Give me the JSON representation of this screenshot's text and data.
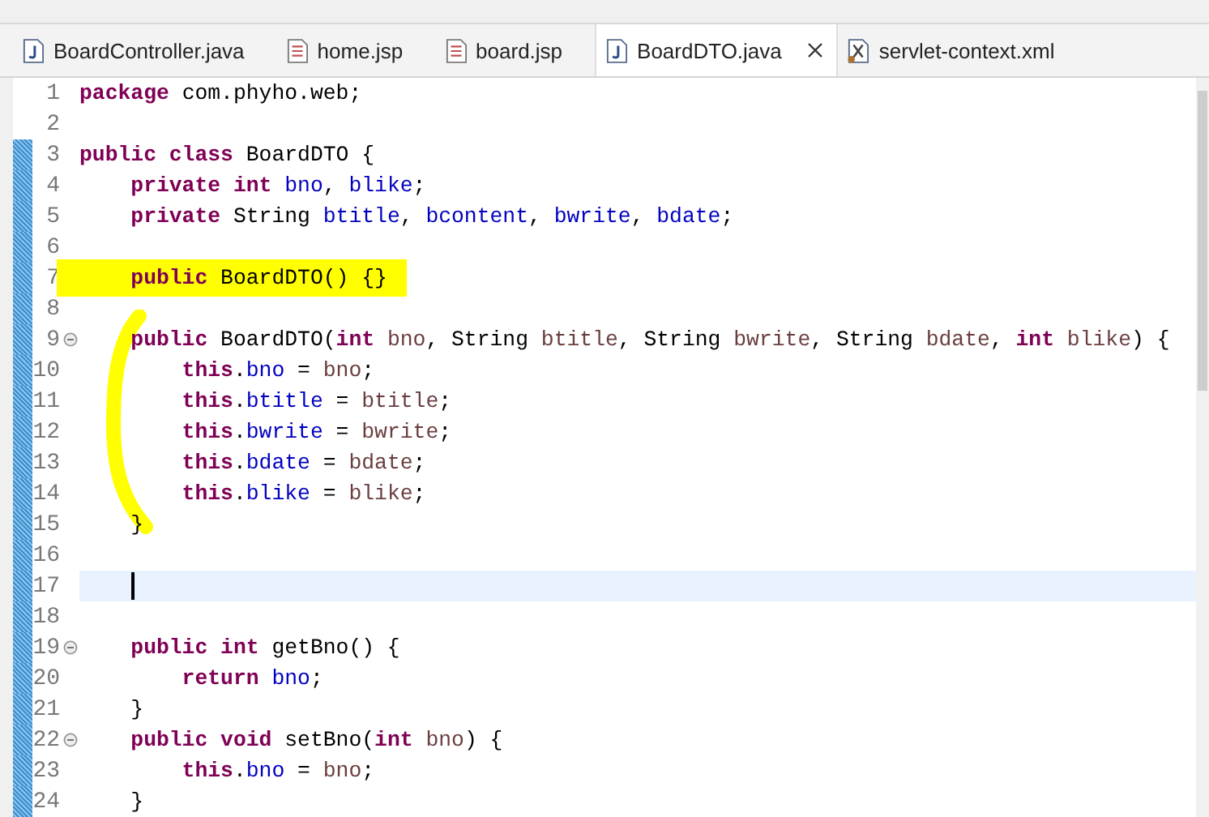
{
  "tabs": [
    {
      "label": "BoardController.java",
      "kind": "java",
      "selected": false
    },
    {
      "label": "home.jsp",
      "kind": "jsp",
      "selected": false
    },
    {
      "label": "board.jsp",
      "kind": "jsp",
      "selected": false
    },
    {
      "label": "BoardDTO.java",
      "kind": "java",
      "selected": true
    },
    {
      "label": "servlet-context.xml",
      "kind": "xml",
      "selected": false
    }
  ],
  "editor": {
    "lines": [
      {
        "number": "1",
        "changed": false,
        "fold": false,
        "current": false,
        "highlighted": false,
        "tokens": [
          {
            "text": "package",
            "kind": "keyword"
          },
          {
            "text": " com.phyho.web;",
            "kind": "plain"
          }
        ]
      },
      {
        "number": "2",
        "changed": false,
        "fold": false,
        "current": false,
        "highlighted": false
      },
      {
        "number": "3",
        "changed": true,
        "fold": false,
        "current": false,
        "highlighted": false,
        "tokens": [
          {
            "text": "public class",
            "kind": "keyword"
          },
          {
            "text": " BoardDTO {",
            "kind": "plain"
          }
        ]
      },
      {
        "number": "4",
        "changed": true,
        "fold": false,
        "current": false,
        "highlighted": false,
        "tokens": [
          {
            "text": "    private int",
            "kind": "keyword"
          },
          {
            "text": " bno",
            "kind": "field"
          },
          {
            "text": ", ",
            "kind": "plain"
          },
          {
            "text": "blike",
            "kind": "field"
          },
          {
            "text": ";",
            "kind": "plain"
          }
        ]
      },
      {
        "number": "5",
        "changed": true,
        "fold": false,
        "current": false,
        "highlighted": false,
        "tokens": [
          {
            "text": "    private",
            "kind": "keyword"
          },
          {
            "text": " String ",
            "kind": "plain"
          },
          {
            "text": "btitle",
            "kind": "field"
          },
          {
            "text": ", ",
            "kind": "plain"
          },
          {
            "text": "bcontent",
            "kind": "field"
          },
          {
            "text": ", ",
            "kind": "plain"
          },
          {
            "text": "bwrite",
            "kind": "field"
          },
          {
            "text": ", ",
            "kind": "plain"
          },
          {
            "text": "bdate",
            "kind": "field"
          },
          {
            "text": ";",
            "kind": "plain"
          }
        ]
      },
      {
        "number": "6",
        "changed": true,
        "fold": false,
        "current": false,
        "highlighted": false
      },
      {
        "number": "7",
        "changed": true,
        "fold": false,
        "current": false,
        "highlighted": true,
        "tokens": [
          {
            "text": "    public",
            "kind": "keyword"
          },
          {
            "text": " BoardDTO() {}",
            "kind": "plain"
          }
        ]
      },
      {
        "number": "8",
        "changed": true,
        "fold": false,
        "current": false,
        "highlighted": false
      },
      {
        "number": "9",
        "changed": true,
        "fold": true,
        "current": false,
        "highlighted": false,
        "tokens": [
          {
            "text": "    public",
            "kind": "keyword"
          },
          {
            "text": " BoardDTO(",
            "kind": "plain"
          },
          {
            "text": "int",
            "kind": "keyword"
          },
          {
            "text": " bno",
            "kind": "param"
          },
          {
            "text": ", String ",
            "kind": "plain"
          },
          {
            "text": "btitle",
            "kind": "param"
          },
          {
            "text": ", String ",
            "kind": "plain"
          },
          {
            "text": "bwrite",
            "kind": "param"
          },
          {
            "text": ", String ",
            "kind": "plain"
          },
          {
            "text": "bdate",
            "kind": "param"
          },
          {
            "text": ", ",
            "kind": "plain"
          },
          {
            "text": "int",
            "kind": "keyword"
          },
          {
            "text": " blike",
            "kind": "param"
          },
          {
            "text": ") {",
            "kind": "plain"
          }
        ]
      },
      {
        "number": "10",
        "changed": true,
        "fold": false,
        "current": false,
        "highlighted": false,
        "tokens": [
          {
            "text": "        this",
            "kind": "keyword"
          },
          {
            "text": ".",
            "kind": "plain"
          },
          {
            "text": "bno",
            "kind": "field"
          },
          {
            "text": " = ",
            "kind": "plain"
          },
          {
            "text": "bno",
            "kind": "param"
          },
          {
            "text": ";",
            "kind": "plain"
          }
        ]
      },
      {
        "number": "11",
        "changed": true,
        "fold": false,
        "current": false,
        "highlighted": false,
        "tokens": [
          {
            "text": "        this",
            "kind": "keyword"
          },
          {
            "text": ".",
            "kind": "plain"
          },
          {
            "text": "btitle",
            "kind": "field"
          },
          {
            "text": " = ",
            "kind": "plain"
          },
          {
            "text": "btitle",
            "kind": "param"
          },
          {
            "text": ";",
            "kind": "plain"
          }
        ]
      },
      {
        "number": "12",
        "changed": true,
        "fold": false,
        "current": false,
        "highlighted": false,
        "tokens": [
          {
            "text": "        this",
            "kind": "keyword"
          },
          {
            "text": ".",
            "kind": "plain"
          },
          {
            "text": "bwrite",
            "kind": "field"
          },
          {
            "text": " = ",
            "kind": "plain"
          },
          {
            "text": "bwrite",
            "kind": "param"
          },
          {
            "text": ";",
            "kind": "plain"
          }
        ]
      },
      {
        "number": "13",
        "changed": true,
        "fold": false,
        "current": false,
        "highlighted": false,
        "tokens": [
          {
            "text": "        this",
            "kind": "keyword"
          },
          {
            "text": ".",
            "kind": "plain"
          },
          {
            "text": "bdate",
            "kind": "field"
          },
          {
            "text": " = ",
            "kind": "plain"
          },
          {
            "text": "bdate",
            "kind": "param"
          },
          {
            "text": ";",
            "kind": "plain"
          }
        ]
      },
      {
        "number": "14",
        "changed": true,
        "fold": false,
        "current": false,
        "highlighted": false,
        "tokens": [
          {
            "text": "        this",
            "kind": "keyword"
          },
          {
            "text": ".",
            "kind": "plain"
          },
          {
            "text": "blike",
            "kind": "field"
          },
          {
            "text": " = ",
            "kind": "plain"
          },
          {
            "text": "blike",
            "kind": "param"
          },
          {
            "text": ";",
            "kind": "plain"
          }
        ]
      },
      {
        "number": "15",
        "changed": true,
        "fold": false,
        "current": false,
        "highlighted": false,
        "tokens": [
          {
            "text": "    }",
            "kind": "plain"
          }
        ]
      },
      {
        "number": "16",
        "changed": true,
        "fold": false,
        "current": false,
        "highlighted": false
      },
      {
        "number": "17",
        "changed": true,
        "fold": false,
        "current": true,
        "highlighted": false
      },
      {
        "number": "18",
        "changed": true,
        "fold": false,
        "current": false,
        "highlighted": false
      },
      {
        "number": "19",
        "changed": true,
        "fold": true,
        "current": false,
        "highlighted": false,
        "tokens": [
          {
            "text": "    public int",
            "kind": "keyword"
          },
          {
            "text": " getBno() {",
            "kind": "plain"
          }
        ]
      },
      {
        "number": "20",
        "changed": true,
        "fold": false,
        "current": false,
        "highlighted": false,
        "tokens": [
          {
            "text": "        return",
            "kind": "keyword"
          },
          {
            "text": " bno",
            "kind": "field"
          },
          {
            "text": ";",
            "kind": "plain"
          }
        ]
      },
      {
        "number": "21",
        "changed": true,
        "fold": false,
        "current": false,
        "highlighted": false,
        "tokens": [
          {
            "text": "    }",
            "kind": "plain"
          }
        ]
      },
      {
        "number": "22",
        "changed": true,
        "fold": true,
        "current": false,
        "highlighted": false,
        "tokens": [
          {
            "text": "    public void",
            "kind": "keyword"
          },
          {
            "text": " setBno(",
            "kind": "plain"
          },
          {
            "text": "int",
            "kind": "keyword"
          },
          {
            "text": " bno",
            "kind": "param"
          },
          {
            "text": ") {",
            "kind": "plain"
          }
        ]
      },
      {
        "number": "23",
        "changed": true,
        "fold": false,
        "current": false,
        "highlighted": false,
        "tokens": [
          {
            "text": "        this",
            "kind": "keyword"
          },
          {
            "text": ".",
            "kind": "plain"
          },
          {
            "text": "bno",
            "kind": "field"
          },
          {
            "text": " = ",
            "kind": "plain"
          },
          {
            "text": "bno",
            "kind": "param"
          },
          {
            "text": ";",
            "kind": "plain"
          }
        ]
      },
      {
        "number": "24",
        "changed": true,
        "fold": false,
        "current": false,
        "highlighted": false,
        "tokens": [
          {
            "text": "    }",
            "kind": "plain"
          }
        ]
      }
    ]
  }
}
